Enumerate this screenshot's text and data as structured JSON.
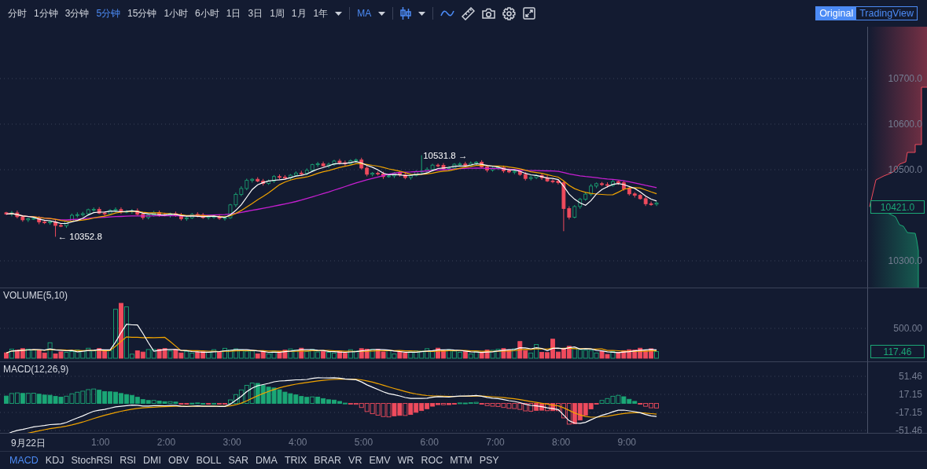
{
  "toolbar": {
    "periods": [
      {
        "label": "分时",
        "selected": false
      },
      {
        "label": "1分钟",
        "selected": false
      },
      {
        "label": "3分钟",
        "selected": false
      },
      {
        "label": "5分钟",
        "selected": true
      },
      {
        "label": "15分钟",
        "selected": false
      },
      {
        "label": "1小时",
        "selected": false
      },
      {
        "label": "6小时",
        "selected": false
      },
      {
        "label": "1日",
        "selected": false
      },
      {
        "label": "3日",
        "selected": false
      },
      {
        "label": "1周",
        "selected": false
      },
      {
        "label": "1月",
        "selected": false
      },
      {
        "label": "1年",
        "selected": false
      }
    ],
    "indicator": "MA"
  },
  "view_switch": [
    {
      "label": "Original",
      "selected": true
    },
    {
      "label": "TradingView",
      "selected": false
    }
  ],
  "main_chart": {
    "price_ticks": [
      "10700.0",
      "10600.0",
      "10500.0",
      "10300.0"
    ],
    "high_label": "10531.8 →",
    "low_label": "← 10352.8",
    "current_price": "10421.0"
  },
  "volume": {
    "title": "VOLUME(5,10)",
    "ticks": [
      "500.00"
    ],
    "current": "117.46"
  },
  "macd": {
    "title": "MACD(12,26,9)",
    "ticks": [
      "51.46",
      "17.15",
      "-17.15",
      "-51.46"
    ]
  },
  "time_axis": [
    "9月22日",
    "1:00",
    "2:00",
    "3:00",
    "4:00",
    "5:00",
    "6:00",
    "7:00",
    "8:00",
    "9:00"
  ],
  "indicator_tabs": [
    {
      "label": "MACD",
      "selected": true
    },
    {
      "label": "KDJ",
      "selected": false
    },
    {
      "label": "StochRSI",
      "selected": false
    },
    {
      "label": "RSI",
      "selected": false
    },
    {
      "label": "DMI",
      "selected": false
    },
    {
      "label": "OBV",
      "selected": false
    },
    {
      "label": "BOLL",
      "selected": false
    },
    {
      "label": "SAR",
      "selected": false
    },
    {
      "label": "DMA",
      "selected": false
    },
    {
      "label": "TRIX",
      "selected": false
    },
    {
      "label": "BRAR",
      "selected": false
    },
    {
      "label": "VR",
      "selected": false
    },
    {
      "label": "EMV",
      "selected": false
    },
    {
      "label": "WR",
      "selected": false
    },
    {
      "label": "ROC",
      "selected": false
    },
    {
      "label": "MTM",
      "selected": false
    },
    {
      "label": "PSY",
      "selected": false
    }
  ]
}
